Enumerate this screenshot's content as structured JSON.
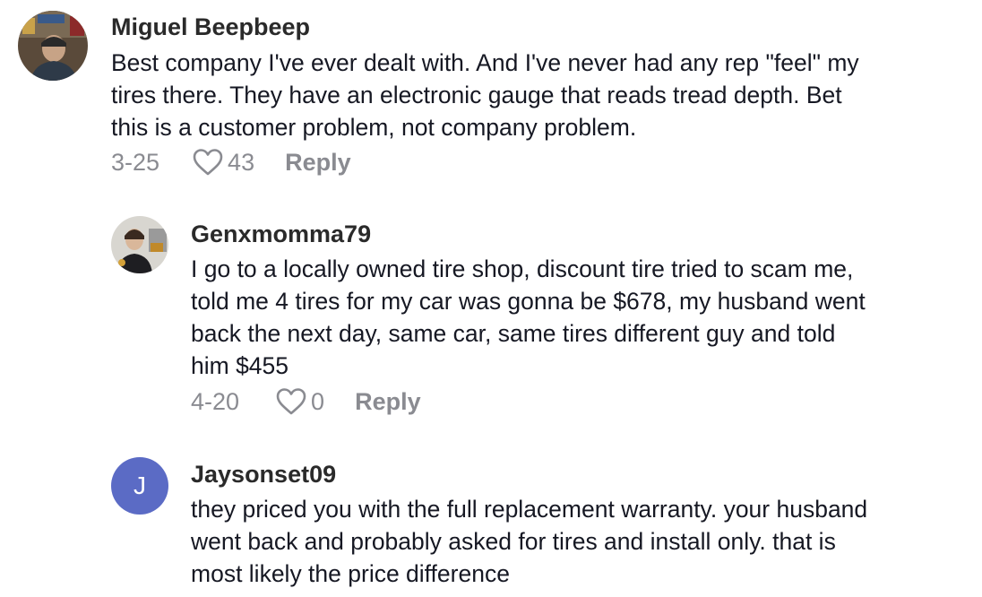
{
  "comments": [
    {
      "username": "Miguel Beepbeep",
      "lines": [
        "Best company I've ever dealt with. And I've never had any rep \"feel\" my",
        "tires there. They have an electronic gauge that reads tread depth. Bet",
        "this is a customer problem, not company problem."
      ],
      "date": "3-25",
      "likes": "43",
      "reply_label": "Reply"
    },
    {
      "username": "Genxmomma79",
      "lines": [
        "I go to a locally owned tire shop, discount tire tried to scam me,",
        "told me 4 tires for my car was gonna be $678, my husband went",
        "back the next day, same car, same tires different guy and told",
        "him $455"
      ],
      "date": "4-20",
      "likes": "0",
      "reply_label": "Reply"
    },
    {
      "username": "Jaysonset09",
      "avatar_letter": "J",
      "avatar_color": "#5b6bc5",
      "lines": [
        "they priced you with the full replacement warranty. your husband",
        "went back and probably asked for tires and install only. that is",
        "most likely the price difference"
      ]
    }
  ],
  "colors": {
    "meta": "#8a8b91",
    "text": "#161823"
  },
  "icons": {
    "like": "heart-outline-icon"
  }
}
